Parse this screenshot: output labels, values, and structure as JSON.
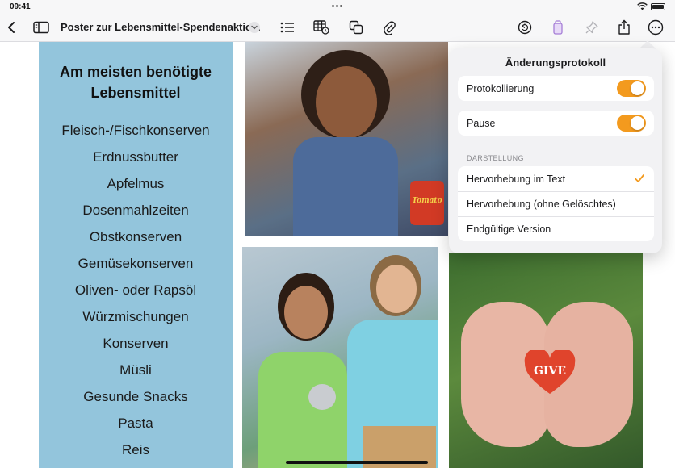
{
  "status_bar": {
    "time": "09:41"
  },
  "toolbar": {
    "document_title": "Poster zur Lebensmittel-Spendenaktio..."
  },
  "poster": {
    "heading_line1": "Am meisten benötigte",
    "heading_line2": "Lebensmittel",
    "items": [
      "Fleisch-/Fischkonserven",
      "Erdnussbutter",
      "Apfelmus",
      "Dosenmahlzeiten",
      "Obstkonserven",
      "Gemüsekonserven",
      "Oliven- oder Rapsöl",
      "Würzmischungen",
      "Konserven",
      "Müsli",
      "Gesunde Snacks",
      "Pasta",
      "Reis"
    ],
    "heart_text": "GIVE",
    "can_label": "Tomato"
  },
  "change_log_popover": {
    "title": "Änderungsprotokoll",
    "tracking_label": "Protokollierung",
    "tracking_on": true,
    "pause_label": "Pause",
    "pause_on": true,
    "section_label": "DARSTELLUNG",
    "options": [
      "Hervorhebung im Text",
      "Hervorhebung (ohne Gelöschtes)",
      "Endgültige Version"
    ],
    "selected_option": "Hervorhebung im Text"
  },
  "colors": {
    "accent": "#F39A1E",
    "poster_panel": "#93C5DC"
  }
}
